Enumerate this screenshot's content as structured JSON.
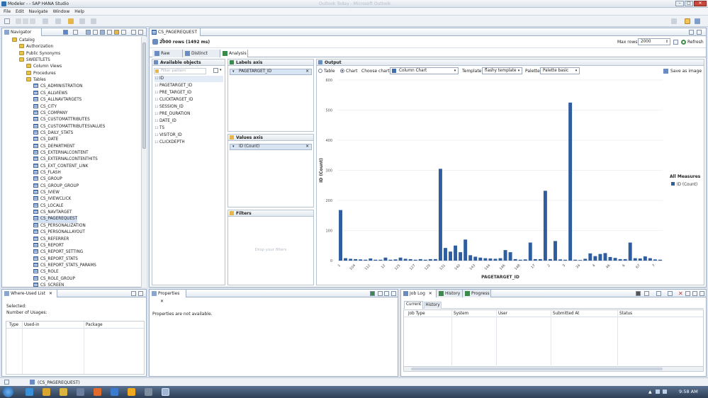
{
  "window": {
    "title": "Modeler - - SAP HANA Studio",
    "ghost_titles": [
      "Outlook Today - Microsoft Outlook"
    ]
  },
  "menu": [
    "File",
    "Edit",
    "Navigate",
    "Window",
    "Help"
  ],
  "navigator": {
    "tab": "Navigator",
    "catalog": "Catalog",
    "items": [
      {
        "label": "Authorization",
        "type": "folder",
        "level": 2
      },
      {
        "label": "Public Synonyms",
        "type": "folder",
        "level": 2
      },
      {
        "label": "SWEETLETS",
        "type": "folder",
        "level": 2
      },
      {
        "label": "Column Views",
        "type": "folder",
        "level": 3
      },
      {
        "label": "Procedures",
        "type": "folder",
        "level": 3
      },
      {
        "label": "Tables",
        "type": "folder",
        "level": 3
      }
    ],
    "tables": [
      "CS_ADMINISTRATION",
      "CS_ALLVIEWS",
      "CS_ALLNAVTARGETS",
      "CS_CITY",
      "CS_COMPANY",
      "CS_CUSTOMATTRIBUTES",
      "CS_CUSTOMATTRIBUTESVALUES",
      "CS_DAILY_STATS",
      "CS_DATE",
      "CS_DEPARTMENT",
      "CS_EXTERNALCONTENT",
      "CS_EXTERNALCONTENTHITS",
      "CS_EXT_CONTENT_LINK",
      "CS_FLASH",
      "CS_GROUP",
      "CS_GROUP_GROUP",
      "CS_IVIEW",
      "CS_IVIEWCLICK",
      "CS_LOCALE",
      "CS_NAVTARGET",
      "CS_PAGEREQUEST",
      "CS_PERSONALIZATION",
      "CS_PERSONALLAYOUT",
      "CS_REFERRER",
      "CS_REPORT",
      "CS_REPORT_SETTING",
      "CS_REPORT_STATS",
      "CS_REPORT_STATS_PARAMS",
      "CS_ROLE",
      "CS_ROLE_GROUP",
      "CS_SCREEN"
    ],
    "selected_table": "CS_PAGEREQUEST"
  },
  "editor": {
    "tab": "CS_PAGEREQUEST",
    "rows_info": "2000 rows (1492 ms)",
    "max_rows_label": "Max rows:",
    "max_rows_value": "2000",
    "refresh_label": "Refresh",
    "subtabs": [
      "Raw Data",
      "Distinct values",
      "Analysis"
    ],
    "available_objects": {
      "title": "Available objects",
      "filter_placeholder": "Filter pattern",
      "fields": [
        "ID",
        "PAGETARGET_ID",
        "PRE_TARGET_ID",
        "CLICKTARGET_ID",
        "SESSION_ID",
        "PRE_DURATION",
        "DATE_ID",
        "TS",
        "VISITOR_ID",
        "CLICKDEPTH"
      ]
    },
    "labels_axis": {
      "title": "Labels axis",
      "item": "PAGETARGET_ID"
    },
    "values_axis": {
      "title": "Values axis",
      "item": "ID (Count)"
    },
    "filters": {
      "title": "Filters",
      "drop_hint": "Drop your filters"
    },
    "output": {
      "title": "Output",
      "table_label": "Table",
      "chart_label": "Chart",
      "choose_chart_label": "Choose chart:",
      "chart_value": "Column Chart",
      "template_label": "Template:",
      "template_value": "flashy template",
      "palette_label": "Palette:",
      "palette_value": "Palette basic",
      "save_label": "Save as image",
      "legend_title": "All Measures",
      "legend_item": "ID (Count)"
    }
  },
  "chart_data": {
    "type": "bar",
    "xlabel": "PAGETARGET_ID",
    "ylabel": "ID (Count)",
    "ylim": [
      0,
      600
    ],
    "yticks": [
      0,
      100,
      200,
      300,
      400,
      500,
      600
    ],
    "tick_every": 3,
    "categories": [
      "1",
      "",
      "",
      "104",
      "",
      "",
      "112",
      "",
      "",
      "12",
      "",
      "",
      "125",
      "",
      "",
      "127",
      "",
      "",
      "129",
      "",
      "",
      "131",
      "",
      "",
      "140",
      "",
      "",
      "143",
      "",
      "",
      "144",
      "",
      "",
      "146",
      "",
      "",
      "148",
      "",
      "",
      "17",
      "",
      "",
      "2",
      "",
      "",
      "3",
      "",
      "",
      "34",
      "",
      "",
      "4",
      "",
      "",
      "46",
      "",
      "",
      "6",
      "",
      "",
      "67",
      "",
      "",
      "7",
      "",
      "",
      "8",
      "",
      "",
      "85",
      "",
      "",
      "9",
      ""
    ],
    "values": [
      168,
      8,
      6,
      5,
      4,
      3,
      7,
      3,
      3,
      10,
      3,
      4,
      10,
      6,
      5,
      3,
      5,
      3,
      5,
      5,
      305,
      42,
      30,
      50,
      28,
      70,
      18,
      13,
      10,
      8,
      7,
      6,
      8,
      35,
      28,
      5,
      3,
      4,
      60,
      5,
      5,
      232,
      5,
      65,
      4,
      3,
      525,
      3,
      2,
      6,
      24,
      15,
      22,
      25,
      12,
      9,
      5,
      5,
      60,
      8,
      7,
      14,
      8,
      4,
      3
    ],
    "color": "#2f5d9e",
    "legend": {
      "title": "All Measures",
      "entries": [
        "ID (Count)"
      ],
      "placement": "right"
    }
  },
  "where_used": {
    "tab": "Where-Used List",
    "selected_label": "Selected:",
    "usages_label": "Number of Usages:",
    "columns": [
      "Type",
      "Used-in",
      "Package"
    ]
  },
  "properties": {
    "tab": "Properties",
    "message": "Properties are not available."
  },
  "job_log": {
    "tabs": [
      "Job Log",
      "History",
      "Progress"
    ],
    "subtabs": [
      "Current",
      "History"
    ],
    "columns": [
      "Job Type",
      "System",
      "User",
      "Submitted At",
      "Status"
    ]
  },
  "status": {
    "text": "(CS_PAGEREQUEST)"
  },
  "taskbar": {
    "time": "9:58 AM"
  }
}
